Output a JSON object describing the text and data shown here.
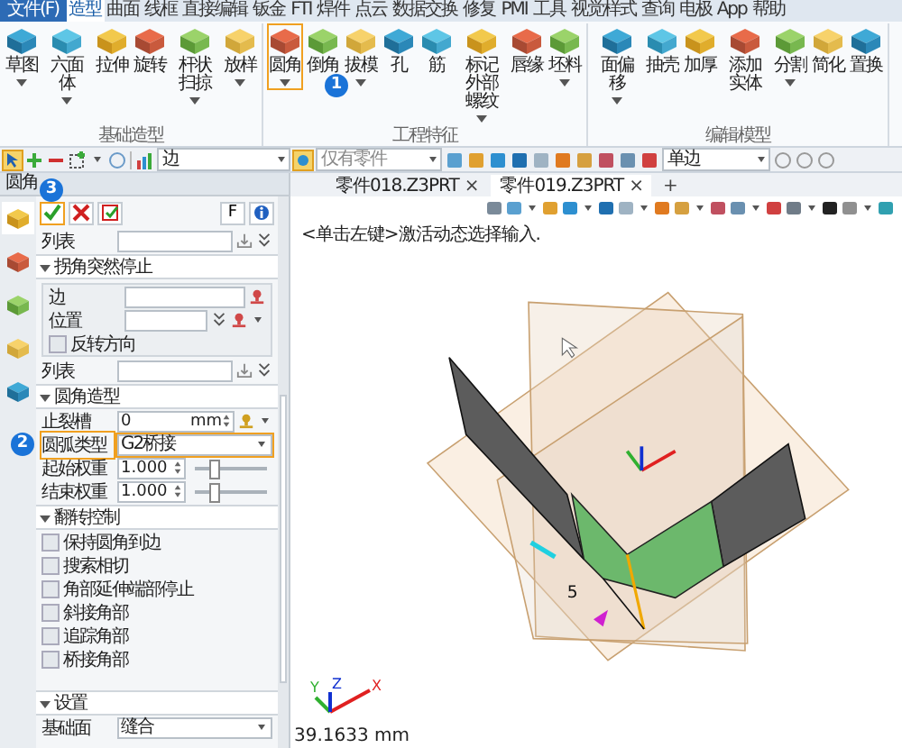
{
  "menu_tabs": [
    {
      "label": "文件(F)",
      "selected": false,
      "kind": "file"
    },
    {
      "label": "造型",
      "selected": true,
      "kind": "tab"
    },
    {
      "label": "曲面",
      "selected": false,
      "kind": "tab"
    },
    {
      "label": "线框",
      "selected": false,
      "kind": "tab"
    },
    {
      "label": "直接编辑",
      "selected": false,
      "kind": "tab"
    },
    {
      "label": "钣金",
      "selected": false,
      "kind": "tab"
    },
    {
      "label": "FTI",
      "selected": false,
      "kind": "tab"
    },
    {
      "label": "焊件",
      "selected": false,
      "kind": "tab"
    },
    {
      "label": "点云",
      "selected": false,
      "kind": "tab"
    },
    {
      "label": "数据交换",
      "selected": false,
      "kind": "tab"
    },
    {
      "label": "修复",
      "selected": false,
      "kind": "tab"
    },
    {
      "label": "PMI",
      "selected": false,
      "kind": "tab"
    },
    {
      "label": "工具",
      "selected": false,
      "kind": "tab"
    },
    {
      "label": "视觉样式",
      "selected": false,
      "kind": "tab"
    },
    {
      "label": "查询",
      "selected": false,
      "kind": "tab"
    },
    {
      "label": "电极",
      "selected": false,
      "kind": "tab"
    },
    {
      "label": "App",
      "selected": false,
      "kind": "tab"
    },
    {
      "label": "帮助",
      "selected": false,
      "kind": "tab"
    }
  ],
  "ribbon": {
    "groups": [
      {
        "label": "基础造型",
        "buttons": [
          {
            "label": "草图",
            "menu": true,
            "highlighted": false
          },
          {
            "label": "六面体",
            "menu": true,
            "highlighted": false
          },
          {
            "label": "拉伸",
            "menu": false,
            "highlighted": false
          },
          {
            "label": "旋转",
            "menu": false,
            "highlighted": false
          },
          {
            "label": "杆状扫掠",
            "menu": true,
            "highlighted": false
          },
          {
            "label": "放样",
            "menu": true,
            "highlighted": false
          }
        ]
      },
      {
        "label": "工程特征",
        "buttons": [
          {
            "label": "圆角",
            "menu": true,
            "highlighted": true,
            "callout": "1"
          },
          {
            "label": "倒角",
            "menu": false,
            "highlighted": false
          },
          {
            "label": "拔模",
            "menu": true,
            "highlighted": false
          },
          {
            "label": "孔",
            "menu": false,
            "highlighted": false
          },
          {
            "label": "筋",
            "menu": false,
            "highlighted": false
          },
          {
            "label": "标记外部螺纹",
            "menu": true,
            "highlighted": false
          },
          {
            "label": "唇缘",
            "menu": false,
            "highlighted": false
          },
          {
            "label": "坯料",
            "menu": true,
            "highlighted": false
          }
        ]
      },
      {
        "label": "编辑模型",
        "buttons": [
          {
            "label": "面偏移",
            "menu": true,
            "highlighted": false
          },
          {
            "label": "抽壳",
            "menu": false,
            "highlighted": false
          },
          {
            "label": "加厚",
            "menu": false,
            "highlighted": false
          },
          {
            "label": "添加实体",
            "menu": false,
            "highlighted": false
          },
          {
            "label": "分割",
            "menu": true,
            "highlighted": false
          },
          {
            "label": "简化",
            "menu": false,
            "highlighted": false
          },
          {
            "label": "置换",
            "menu": false,
            "highlighted": false
          }
        ]
      }
    ]
  },
  "toolbar": {
    "edge_filter": "边",
    "scope_filter": "仅有零件",
    "edge_mode": "单边"
  },
  "panel": {
    "title": "圆角",
    "callout": "3",
    "ok_highlighted": true,
    "f_label": "F",
    "side_tabs": [
      {
        "selected": true
      },
      {
        "selected": false
      },
      {
        "selected": false
      },
      {
        "selected": false
      },
      {
        "selected": false
      }
    ],
    "top_rows": [
      {
        "kind": "list",
        "label": "列表"
      }
    ],
    "sections": [
      {
        "title": "拐角突然停止",
        "expanded": true,
        "rows": [
          {
            "kind": "group",
            "rows": [
              {
                "kind": "pick",
                "label": "边"
              },
              {
                "kind": "pick2",
                "label": "位置"
              },
              {
                "kind": "check",
                "label": "反转方向",
                "checked": false
              }
            ]
          },
          {
            "kind": "list",
            "label": "列表"
          }
        ]
      },
      {
        "title": "圆角造型",
        "expanded": true,
        "rows": [
          {
            "kind": "spin",
            "label": "止裂槽",
            "value": "0",
            "unit": "mm"
          },
          {
            "kind": "select",
            "label": "圆弧类型",
            "value": "G2桥接",
            "highlighted": true,
            "callout": "2"
          },
          {
            "kind": "weight",
            "label": "起始权重",
            "value": "1.000",
            "level": 0.25
          },
          {
            "kind": "weight",
            "label": "结束权重",
            "value": "1.000",
            "level": 0.25
          }
        ]
      },
      {
        "title": "翻转控制",
        "expanded": true,
        "rows": [
          {
            "kind": "check",
            "label": "保持圆角到边",
            "checked": false
          },
          {
            "kind": "check",
            "label": "搜索相切",
            "checked": false
          },
          {
            "kind": "check",
            "label": "角部延伸端部停止",
            "checked": false
          },
          {
            "kind": "check",
            "label": "斜接角部",
            "checked": false
          },
          {
            "kind": "check",
            "label": "追踪角部",
            "checked": false
          },
          {
            "kind": "check",
            "label": "桥接角部",
            "checked": false
          }
        ]
      },
      {
        "title": "设置",
        "expanded": true,
        "rows": [
          {
            "kind": "select",
            "label": "基础面",
            "value": "缝合",
            "highlighted": false
          }
        ]
      }
    ]
  },
  "doc_tabs": [
    {
      "label": "零件018.Z3PRT",
      "close": "×",
      "selected": false
    },
    {
      "label": "零件019.Z3PRT",
      "close": "×",
      "selected": true
    }
  ],
  "new_tab": "+",
  "prompt": "<单击左键>激活动态选择输入.",
  "dimension": "5",
  "axis_labels": {
    "x": "X",
    "y": "Y",
    "z": "Z"
  },
  "measurement": "39.1633 mm"
}
